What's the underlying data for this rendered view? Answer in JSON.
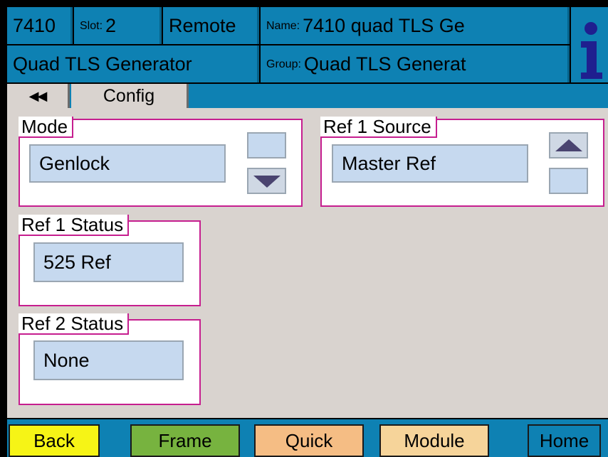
{
  "header": {
    "model": "7410",
    "slot_label": "Slot:",
    "slot_value": "2",
    "mode": "Remote",
    "name_label": "Name:",
    "name_value": "7410 quad TLS Ge",
    "description": "Quad TLS Generator",
    "group_label": "Group:",
    "group_value": "Quad TLS Generat",
    "info_icon": "info-icon"
  },
  "tabs": {
    "back_arrows": "◀◀",
    "config": "Config"
  },
  "panels": {
    "mode": {
      "label": "Mode",
      "value": "Genlock"
    },
    "ref1_source": {
      "label": "Ref 1  Source",
      "value": "Master Ref"
    },
    "ref1_status": {
      "label": "Ref 1 Status",
      "value": "525 Ref"
    },
    "ref2_status": {
      "label": "Ref 2 Status",
      "value": "None"
    }
  },
  "footer": {
    "back": "Back",
    "frame": "Frame",
    "quick": "Quick",
    "module": "Module",
    "home": "Home"
  },
  "colors": {
    "header_blue": "#0e81b3",
    "panel_border": "#c61e8f",
    "field_bg": "#c6d9ef",
    "back_btn": "#f6f416",
    "frame_btn": "#77b33f",
    "quick_btn": "#f5bd84",
    "module_btn": "#f6d49a",
    "home_btn": "#0e81b3"
  }
}
